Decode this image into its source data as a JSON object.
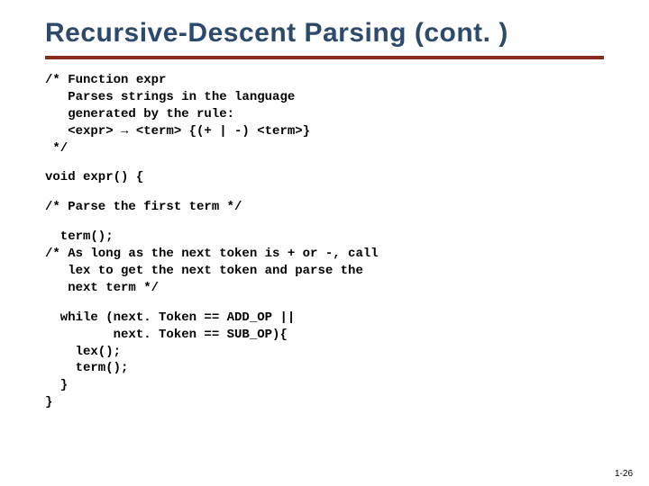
{
  "title": "Recursive-Descent Parsing (cont. )",
  "code": {
    "block1": "/* Function expr\n   Parses strings in the language\n   generated by the rule:\n   <expr> → <term> {(+ | -) <term>}\n */",
    "block2": "void expr() {",
    "block3": "/* Parse the first term */",
    "block4": "  term();\n/* As long as the next token is + or -, call\n   lex to get the next token and parse the\n   next term */",
    "block5": "  while (next. Token == ADD_OP ||\n         next. Token == SUB_OP){\n    lex();\n    term();\n  }\n}"
  },
  "page_number": "1-26"
}
